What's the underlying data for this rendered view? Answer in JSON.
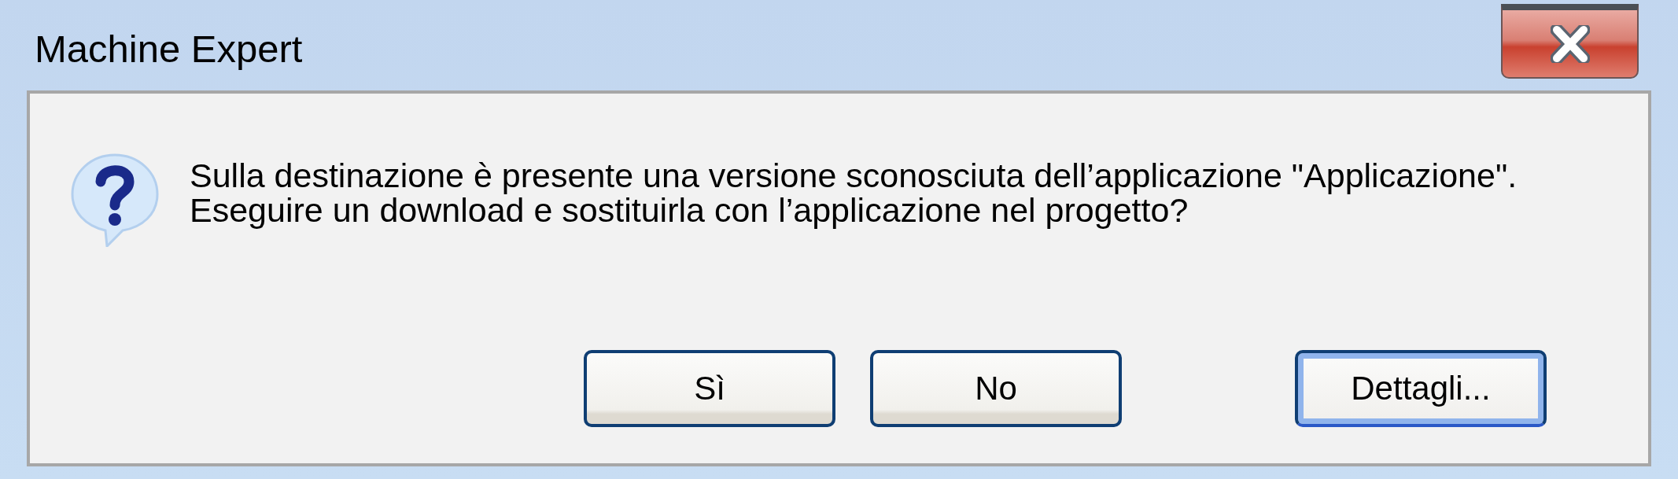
{
  "window": {
    "title": "Machine Expert"
  },
  "message": {
    "lines": [
      "Sulla destinazione è presente una versione sconosciuta dell’applicazione \"Applicazione\".",
      "Eseguire un download e sostituirla con l’applicazione nel progetto?"
    ]
  },
  "buttons": [
    {
      "label": "Sì",
      "default": false
    },
    {
      "label": "No",
      "default": false
    },
    {
      "label": "Dettagli...",
      "default": true
    }
  ]
}
